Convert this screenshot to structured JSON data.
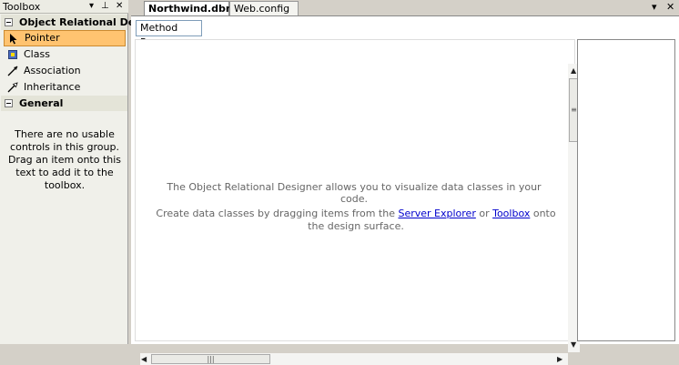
{
  "toolbox": {
    "title": "Toolbox",
    "controls": {
      "dropdown": "▾",
      "pin": "⊥",
      "close": "✕"
    },
    "groups": [
      {
        "label": "Object Relational Designer",
        "display_label": "Object Relational Des...",
        "items": [
          {
            "label": "Pointer",
            "icon": "pointer-icon",
            "selected": true
          },
          {
            "label": "Class",
            "icon": "class-icon"
          },
          {
            "label": "Association",
            "icon": "association-icon"
          },
          {
            "label": "Inheritance",
            "icon": "inheritance-icon"
          }
        ]
      },
      {
        "label": "General",
        "empty_message": "There are no usable controls in this group. Drag an item onto this text to add it to the toolbox."
      }
    ]
  },
  "tabs": {
    "items": [
      {
        "label": "Northwind.dbml*",
        "active": true
      },
      {
        "label": "Web.config",
        "active": false
      }
    ],
    "controls": {
      "dropdown": "▾",
      "close": "✕"
    }
  },
  "editor": {
    "method_pane_label": "Method Pane",
    "hint_line1": "The Object Relational Designer allows you to visualize data classes in your code.",
    "hint_line2_prefix": "Create data classes by dragging items from the ",
    "server_explorer_link": "Server Explorer",
    "hint_line2_middle": " or ",
    "toolbox_link": "Toolbox",
    "hint_line2_suffix": " onto the design surface."
  },
  "colors": {
    "selection_fill": "#ffc370",
    "selection_border": "#cc8a30",
    "link": "#0000cc",
    "hint_text": "#666666"
  }
}
